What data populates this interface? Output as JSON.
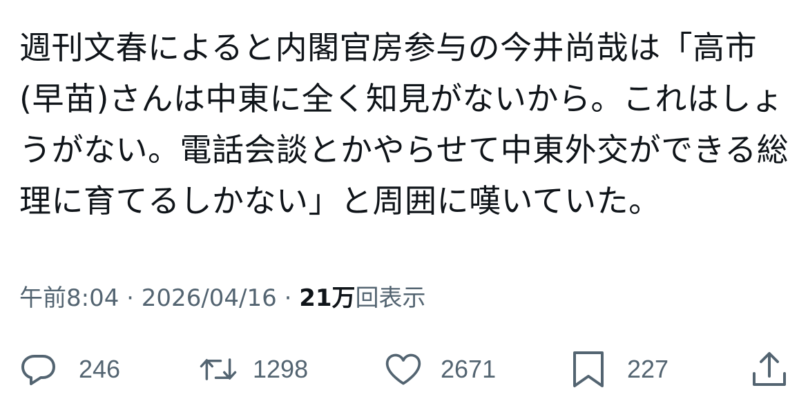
{
  "tweet": {
    "text": "週刊文春によると内閣官房参与の今井尚哉は「高市(早苗)さんは中東に全く知見がないから。これはしょうがない。電話会談とかやらせて中東外交ができる総理に育てるしかない」と周囲に嘆いていた。"
  },
  "meta": {
    "time": "午前8:04",
    "separator": "·",
    "date": "2026/04/16",
    "views_count": "21万",
    "views_label": "回表示"
  },
  "actions": {
    "reply": {
      "icon": "reply-icon",
      "count": "246"
    },
    "retweet": {
      "icon": "retweet-icon",
      "count": "1298"
    },
    "like": {
      "icon": "heart-icon",
      "count": "2671"
    },
    "bookmark": {
      "icon": "bookmark-icon",
      "count": "227"
    },
    "share": {
      "icon": "share-icon"
    }
  },
  "colors": {
    "text": "#0f1419",
    "secondary": "#536471",
    "background": "#ffffff"
  }
}
